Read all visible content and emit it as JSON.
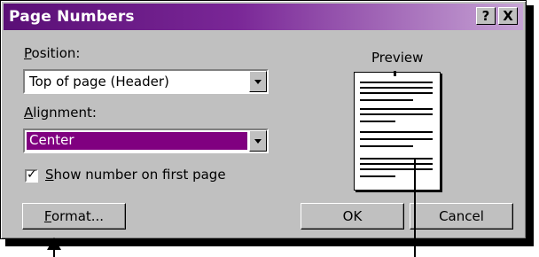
{
  "dialog": {
    "title": "Page Numbers",
    "help_button": "?",
    "close_button": "X"
  },
  "position": {
    "label_first": "P",
    "label_rest": "osition:",
    "value": "Top of page (Header)"
  },
  "alignment": {
    "label_first": "A",
    "label_rest": "lignment:",
    "value": "Center"
  },
  "show_first": {
    "checked": true,
    "label_first": "S",
    "label_rest": "how number on first page"
  },
  "preview": {
    "label": "Preview"
  },
  "buttons": {
    "format_first": "F",
    "format_rest": "ormat...",
    "ok": "OK",
    "cancel": "Cancel"
  },
  "colors": {
    "selection": "#800080",
    "title_start": "#5a0f76",
    "title_end": "#c7a4d5"
  }
}
